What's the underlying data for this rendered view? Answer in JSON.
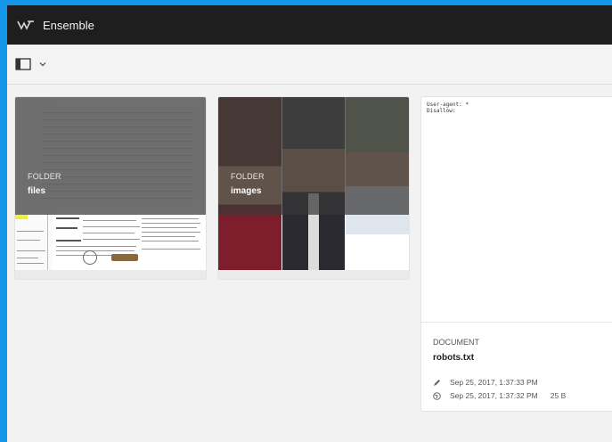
{
  "app": {
    "title": "Ensemble"
  },
  "toolbar": {
    "rail_icon": "rail-toggle-icon",
    "chevron_icon": "chevron-down-icon"
  },
  "cards": [
    {
      "type": "FOLDER",
      "name": "files"
    },
    {
      "type": "FOLDER",
      "name": "images"
    },
    {
      "type": "DOCUMENT",
      "name": "robots.txt",
      "preview": "User-agent: *\nDisallow:",
      "modified": "Sep 25, 2017, 1:37:33 PM",
      "published": "Sep 25, 2017, 1:37:32 PM",
      "size": "25 B"
    }
  ],
  "colors": {
    "accent": "#1396e8",
    "titlebar": "#1e1e1e",
    "canvas": "#f2f2f2"
  }
}
